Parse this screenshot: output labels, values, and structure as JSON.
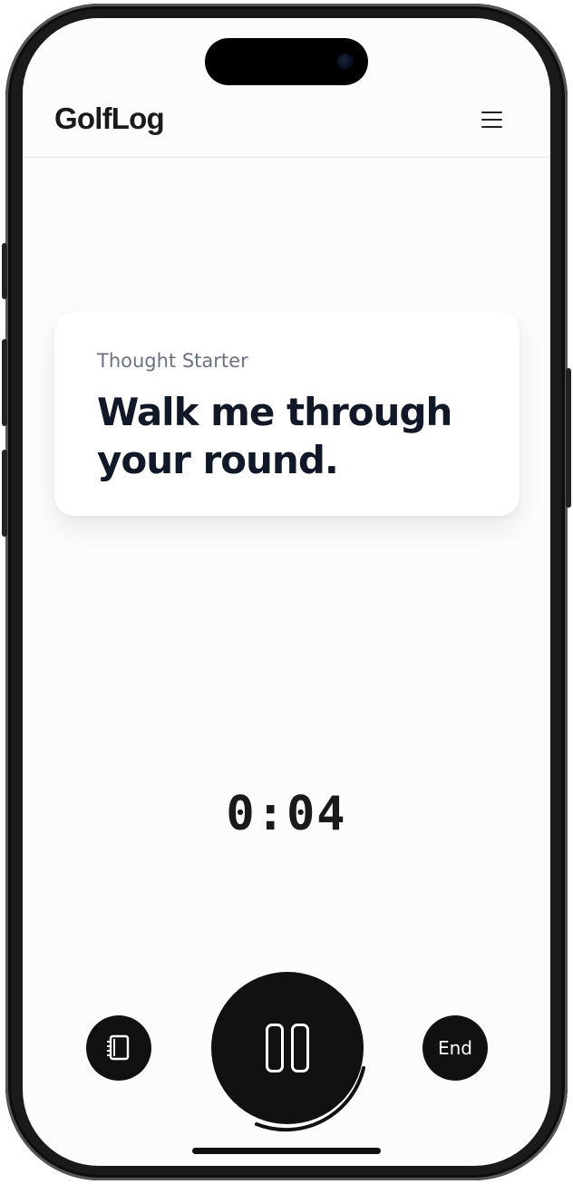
{
  "header": {
    "brand": "GolfLog",
    "menu_icon": "hamburger-menu-icon"
  },
  "prompt_card": {
    "label": "Thought Starter",
    "text": "Walk me through your round."
  },
  "recording": {
    "timer": "0:04",
    "pause_icon": "pause-icon",
    "notes_icon": "notebook-icon",
    "end_label": "End"
  },
  "colors": {
    "button_fill": "#111111",
    "background": "#fcfcfc",
    "card_label": "#6b7280",
    "card_text": "#111827"
  }
}
